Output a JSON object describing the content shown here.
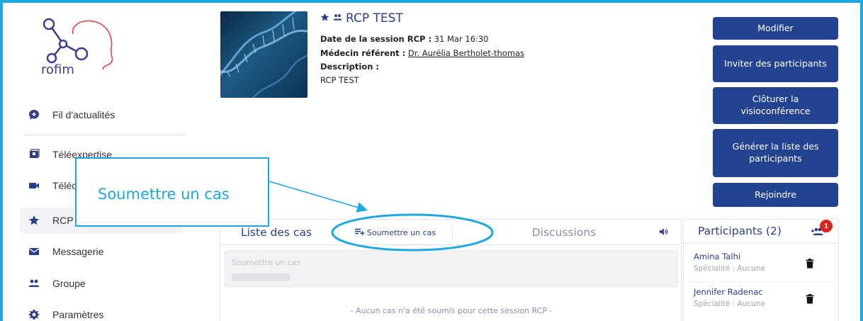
{
  "app": {
    "logo_text": "rofim"
  },
  "sidebar": {
    "items": [
      {
        "label": "Fil d'actualités",
        "icon": "chat-plus-icon"
      },
      {
        "label": "Téléexpertise",
        "icon": "book-icon"
      },
      {
        "label": "Téléc",
        "icon": "video-camera-icon"
      },
      {
        "label": "RCP",
        "icon": "star-icon"
      },
      {
        "label": "Messagerie",
        "icon": "envelope-icon"
      },
      {
        "label": "Groupe",
        "icon": "group-icon"
      },
      {
        "label": "Paramètres",
        "icon": "gear-icon"
      }
    ]
  },
  "session": {
    "title": "RCP TEST",
    "date_label": "Date de la session RCP :",
    "date_value": "31 Mar 16:30",
    "doctor_label": "Médecin référent :",
    "doctor_value": "Dr. Aurélia Bertholet-thomas",
    "description_label": "Description :",
    "description_value": "RCP TEST"
  },
  "actions": {
    "modify": "Modifier",
    "invite": "Inviter des participants",
    "close_visio": "Clôturer la visioconférence",
    "generate_list": "Générer la liste des participants",
    "join": "Rejoindre"
  },
  "callout": {
    "text": "Soumettre un cas"
  },
  "cases": {
    "tab_list": "Liste des cas",
    "tab_submit": "Soumettre un cas",
    "tab_discussions": "Discussions",
    "submit_placeholder": "Soumettre un cas",
    "empty_message": "- Aucun cas n'a été soumis pour cette session RCP -"
  },
  "participants": {
    "title": "Participants (2)",
    "badge_count": "1",
    "people": [
      {
        "name": "Amina Talhi",
        "specialty": "Spécialité : Aucune"
      },
      {
        "name": "Jennifer Radenac",
        "specialty": "Spécialité : Aucune"
      }
    ]
  },
  "colors": {
    "primary": "#23428f",
    "accent_callout": "#1ea7e0",
    "badge": "#d9251c"
  }
}
